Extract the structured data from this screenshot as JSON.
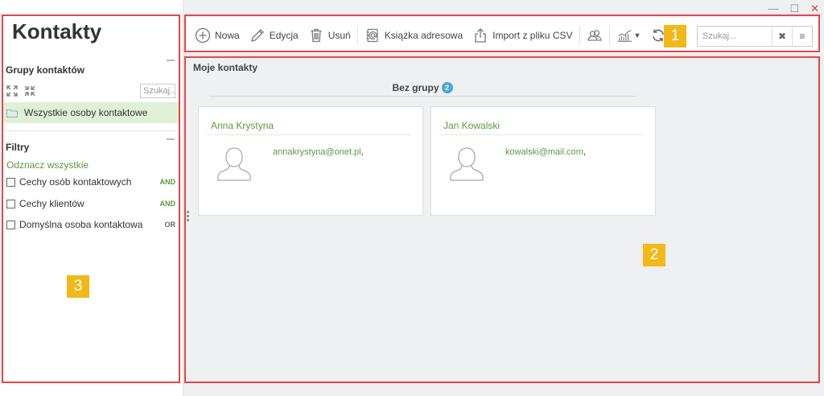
{
  "window": {
    "minimize": "—",
    "maximize": "☐",
    "close": "✕"
  },
  "sidebar": {
    "title": "Kontakty",
    "groups_title": "Grupy kontaktów",
    "search_placeholder": "Szukaj...",
    "groups": [
      {
        "label": "Wszystkie osoby kontaktowe",
        "selected": true
      }
    ],
    "filters_title": "Filtry",
    "clear_all": "Odznacz wszystkie",
    "filters": [
      {
        "label": "Cechy osób kontaktowych",
        "operator": "AND"
      },
      {
        "label": "Cechy klientów",
        "operator": "AND"
      },
      {
        "label": "Domyślna osoba kontaktowa",
        "operator": "OR"
      }
    ]
  },
  "toolbar": {
    "new_label": "Nowa",
    "edit_label": "Edycja",
    "delete_label": "Usuń",
    "addressbook_label": "Książka adresowa",
    "import_label": "Import z pliku CSV",
    "search_placeholder": "Szukaj..."
  },
  "main": {
    "title": "Moje kontakty",
    "group_name": "Bez grupy",
    "group_count": "2",
    "contacts": [
      {
        "name": "Anna Krystyna",
        "email": "annakrystyna@onet.pl",
        "sep": ","
      },
      {
        "name": "Jan Kowalski",
        "email": "kowalski@mail.com",
        "sep": ","
      }
    ]
  },
  "annotations": [
    "1",
    "2",
    "3"
  ],
  "colors": {
    "accent_green": "#5b9a3f",
    "badge_blue": "#49a3e0",
    "annotation_red": "#e64545",
    "annotation_yellow": "#f1b81a"
  }
}
